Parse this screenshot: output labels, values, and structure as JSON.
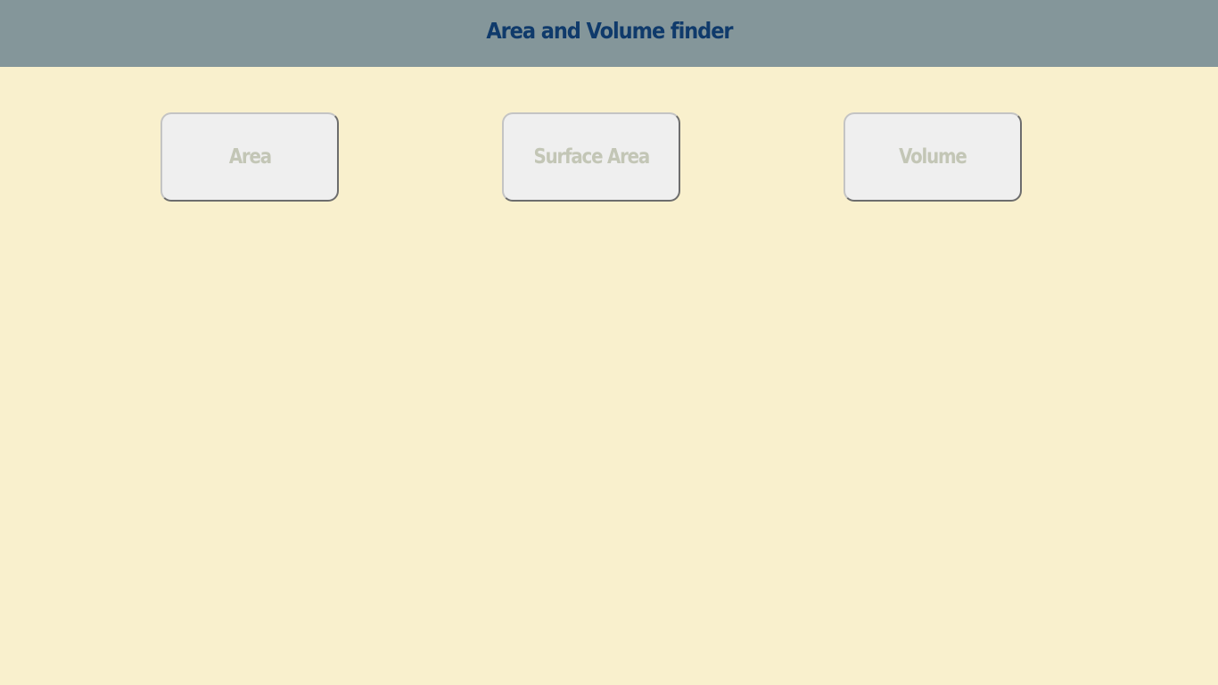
{
  "header": {
    "title": "Area and Volume finder"
  },
  "buttons": {
    "area_label": "Area",
    "surface_area_label": "Surface Area",
    "volume_label": "Volume"
  },
  "colors": {
    "background": "#f9f0cd",
    "header_background": "#84969a",
    "title_text": "#0f3a6b",
    "button_background": "#efefef",
    "button_text": "#c3c6b6"
  }
}
